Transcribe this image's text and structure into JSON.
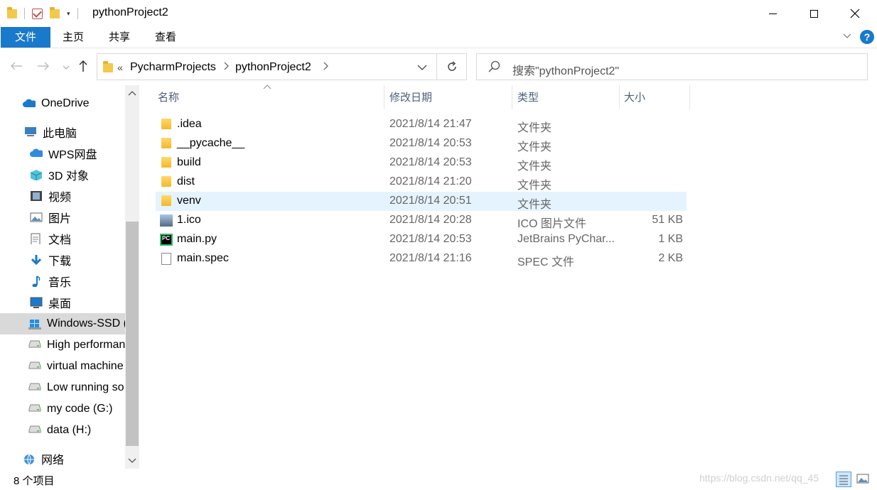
{
  "window": {
    "title": "pythonProject2",
    "minimize": "—",
    "maximize": "☐",
    "close": "✕"
  },
  "ribbon": {
    "tabs": [
      "文件",
      "主页",
      "共享",
      "查看"
    ],
    "help": "?"
  },
  "nav": {
    "breadcrumb_prefix": "«",
    "breadcrumb": [
      "PycharmProjects",
      "pythonProject2"
    ],
    "search_placeholder": "搜索\"pythonProject2\""
  },
  "sidebar": {
    "items": [
      {
        "label": "OneDrive",
        "icon": "cloud-icon"
      },
      {
        "label": "此电脑",
        "icon": "computer-icon"
      },
      {
        "label": "WPS网盘",
        "icon": "cloud-icon"
      },
      {
        "label": "3D 对象",
        "icon": "cube-icon"
      },
      {
        "label": "视频",
        "icon": "video-icon"
      },
      {
        "label": "图片",
        "icon": "picture-icon"
      },
      {
        "label": "文档",
        "icon": "document-icon"
      },
      {
        "label": "下载",
        "icon": "download-icon"
      },
      {
        "label": "音乐",
        "icon": "music-icon"
      },
      {
        "label": "桌面",
        "icon": "desktop-icon"
      },
      {
        "label": "Windows-SSD (",
        "icon": "windows-drive-icon"
      },
      {
        "label": "High performan",
        "icon": "drive-icon"
      },
      {
        "label": "virtual machine",
        "icon": "drive-icon"
      },
      {
        "label": "Low running so",
        "icon": "drive-icon"
      },
      {
        "label": "my code (G:)",
        "icon": "drive-icon"
      },
      {
        "label": "data (H:)",
        "icon": "drive-icon"
      },
      {
        "label": "网络",
        "icon": "network-icon"
      }
    ]
  },
  "columns": {
    "name": "名称",
    "date": "修改日期",
    "type": "类型",
    "size": "大小"
  },
  "files": [
    {
      "name": ".idea",
      "date": "2021/8/14 21:47",
      "type": "文件夹",
      "size": "",
      "icon": "folder-icon"
    },
    {
      "name": "__pycache__",
      "date": "2021/8/14 20:53",
      "type": "文件夹",
      "size": "",
      "icon": "folder-icon"
    },
    {
      "name": "build",
      "date": "2021/8/14 20:53",
      "type": "文件夹",
      "size": "",
      "icon": "folder-icon"
    },
    {
      "name": "dist",
      "date": "2021/8/14 21:20",
      "type": "文件夹",
      "size": "",
      "icon": "folder-icon"
    },
    {
      "name": "venv",
      "date": "2021/8/14 20:51",
      "type": "文件夹",
      "size": "",
      "icon": "folder-icon"
    },
    {
      "name": "1.ico",
      "date": "2021/8/14 20:28",
      "type": "ICO 图片文件",
      "size": "51 KB",
      "icon": "image-file-icon"
    },
    {
      "name": "main.py",
      "date": "2021/8/14 20:53",
      "type": "JetBrains PyChar...",
      "size": "1 KB",
      "icon": "pycharm-file-icon"
    },
    {
      "name": "main.spec",
      "date": "2021/8/14 21:16",
      "type": "SPEC 文件",
      "size": "2 KB",
      "icon": "file-icon"
    }
  ],
  "status": {
    "count": "8 个项目",
    "watermark": "https://blog.csdn.net/qq_45"
  }
}
